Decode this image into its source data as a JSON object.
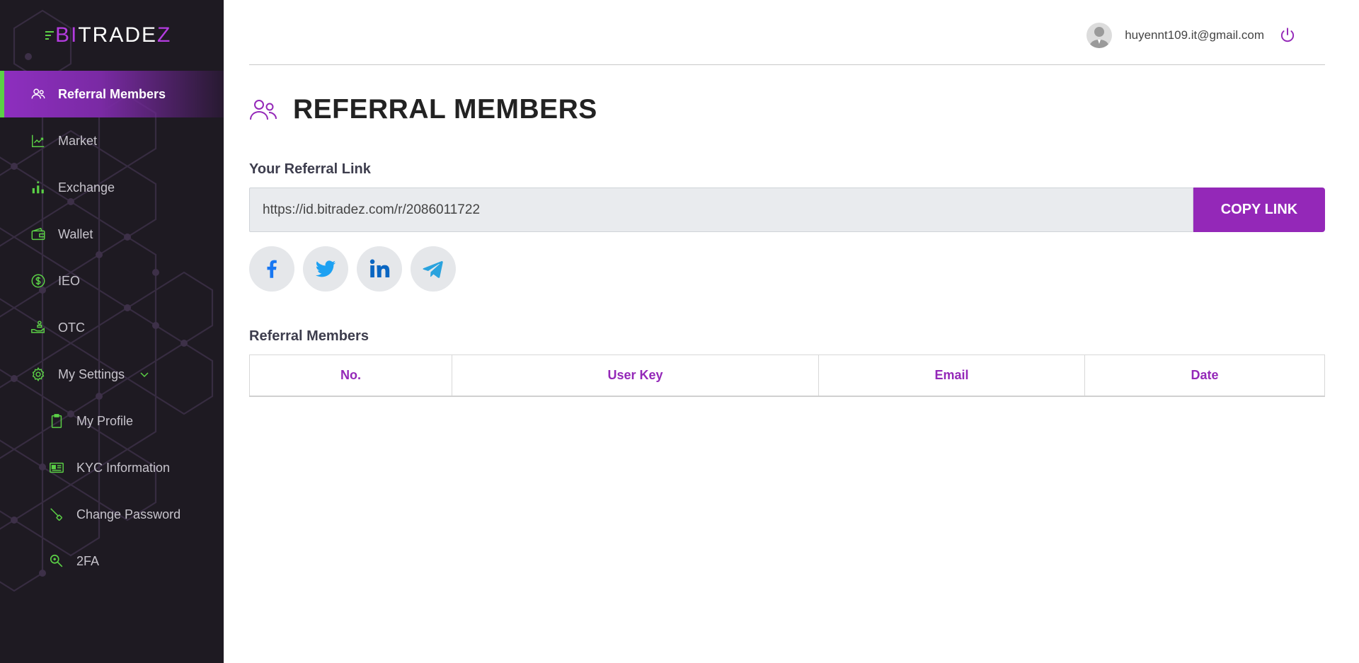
{
  "app": {
    "logo_prefix": "BI",
    "logo_mid": "TRADE",
    "logo_suffix": "Z",
    "logo_text": "BITRADEZ"
  },
  "sidebar": {
    "items": [
      {
        "label": "Referral Members",
        "icon": "users-icon",
        "active": true
      },
      {
        "label": "Market",
        "icon": "chart-line-icon"
      },
      {
        "label": "Exchange",
        "icon": "exchange-bars-icon"
      },
      {
        "label": "Wallet",
        "icon": "wallet-icon"
      },
      {
        "label": "IEO",
        "icon": "dollar-circle-icon"
      },
      {
        "label": "OTC",
        "icon": "hand-coin-icon"
      },
      {
        "label": "My Settings",
        "icon": "gear-icon",
        "expanded": true
      },
      {
        "label": "My Profile",
        "icon": "clipboard-icon",
        "sub": true
      },
      {
        "label": "KYC Information",
        "icon": "id-card-icon",
        "sub": true
      },
      {
        "label": "Change Password",
        "icon": "key-icon",
        "sub": true
      },
      {
        "label": "2FA",
        "icon": "search-key-icon",
        "sub": true
      }
    ]
  },
  "header": {
    "email": "huyennt109.it@gmail.com"
  },
  "page": {
    "title": "REFERRAL MEMBERS",
    "referral_link_label": "Your Referral Link",
    "referral_link_value": "https://id.bitradez.com/r/2086011722",
    "copy_button": "COPY LINK",
    "members_label": "Referral Members",
    "table_headers": [
      "No.",
      "User Key",
      "Email",
      "Date"
    ]
  },
  "colors": {
    "accent": "#9428b8",
    "sidebar_bg": "#1e1a22",
    "icon_green": "#5bd046",
    "facebook": "#1877f2",
    "twitter": "#1da1f2",
    "linkedin": "#0a66c2",
    "telegram": "#2aa3de"
  }
}
